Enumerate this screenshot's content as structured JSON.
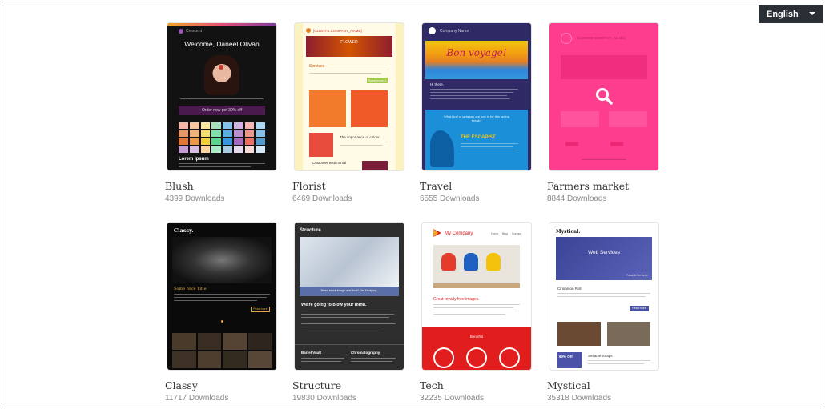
{
  "language_selector": {
    "label": "English"
  },
  "templates": [
    {
      "name": "Blush",
      "downloads": "4399 Downloads",
      "preview": {
        "brand": "Crescent",
        "heading": "Welcome, Daneel Olivan",
        "cta": "Order now get 30% off",
        "subheading": "Lorem Ipsum"
      }
    },
    {
      "name": "Florist",
      "downloads": "6469 Downloads",
      "preview": {
        "company": "[CLIENTS.COMPANY_NAME]",
        "banner": "FLOWER",
        "section": "Services",
        "button": "Read more »",
        "article": "The importance of colour",
        "footer": "Customer testimonial"
      }
    },
    {
      "name": "Travel",
      "downloads": "6555 Downloads",
      "preview": {
        "company": "Company Name",
        "hero": "Bon voyage!",
        "greeting": "Hi there,",
        "question": "What kind of getaway are you in for this spring break?",
        "section": "THE ESCAPIST"
      }
    },
    {
      "name": "Farmers market",
      "downloads": "8844 Downloads",
      "preview": {
        "company": "[CLIENTS.COMPANY_NAME]"
      }
    },
    {
      "name": "Classy",
      "downloads": "11717 Downloads",
      "preview": {
        "brand": "Classy.",
        "heading": "Some Nice Title",
        "button": "Read more"
      }
    },
    {
      "name": "Structure",
      "downloads": "19830 Downloads",
      "preview": {
        "brand": "Structure",
        "caption": "Need stock image and font? Get Hedging.",
        "heading": "We're going to blow your mind.",
        "col1": "Barrel Vault",
        "col2": "Chromatography"
      }
    },
    {
      "name": "Tech",
      "downloads": "32235 Downloads",
      "preview": {
        "company": "My Company",
        "nav": [
          "Home",
          "Blog",
          "Contact"
        ],
        "heading": "Great royalty free images.",
        "section": "Benefits"
      }
    },
    {
      "name": "Mystical",
      "downloads": "35318 Downloads",
      "preview": {
        "brand": "Mystical.",
        "hero": "Web Services",
        "badge": "Pakai & Services",
        "item": "Cinnamon Roll",
        "button": "Read more",
        "offer": "60% Off",
        "product": "Sesame Snaps"
      }
    }
  ],
  "colors": {
    "blush_bg": "#121212",
    "florist_bg": "#fbf2c0",
    "travel_bg": "#2d2a66",
    "farmers_bg": "#ff3d8f",
    "classy_bg": "#0a0a0a",
    "structure_bg": "#2e2e2e",
    "tech_red": "#e21d1d",
    "mystical_blue": "#4a53a8"
  }
}
